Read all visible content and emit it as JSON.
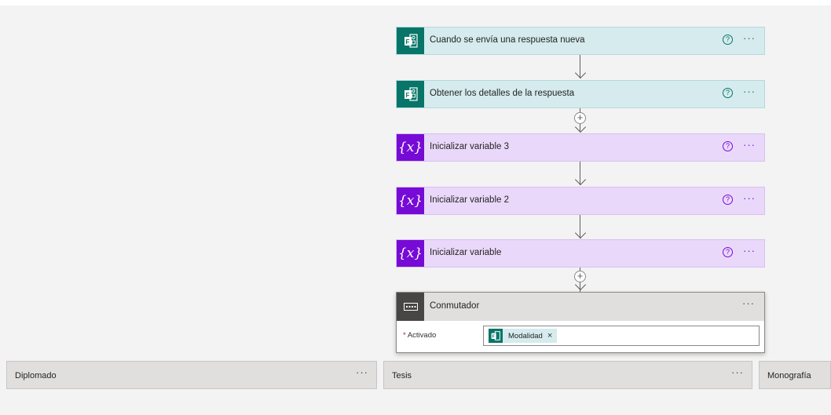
{
  "steps": [
    {
      "title": "Cuando se envía una respuesta nueva",
      "icon": "microsoft-forms-icon",
      "help": "?",
      "more": "···"
    },
    {
      "title": "Obtener los detalles de la respuesta",
      "icon": "microsoft-forms-icon",
      "help": "?",
      "more": "···"
    },
    {
      "title": "Inicializar variable 3",
      "icon": "variable-icon",
      "icon_text": "{x}",
      "help": "?",
      "more": "···"
    },
    {
      "title": "Inicializar variable 2",
      "icon": "variable-icon",
      "icon_text": "{x}",
      "help": "?",
      "more": "···"
    },
    {
      "title": "Inicializar variable",
      "icon": "variable-icon",
      "icon_text": "{x}",
      "help": "?",
      "more": "···"
    }
  ],
  "switch": {
    "title": "Conmutador",
    "icon": "switch-icon",
    "more": "···",
    "on_label": "Activado",
    "required_mark": "*",
    "token": {
      "label": "Modalidad",
      "icon": "microsoft-forms-icon",
      "remove": "×"
    }
  },
  "add_step": "+",
  "cases": [
    {
      "title": "Diplomado",
      "more": "···"
    },
    {
      "title": "Tesis",
      "more": "···"
    },
    {
      "title": "Monografía"
    }
  ],
  "colors": {
    "forms": "#077568",
    "variable": "#770bd6",
    "switch": "#484644"
  }
}
